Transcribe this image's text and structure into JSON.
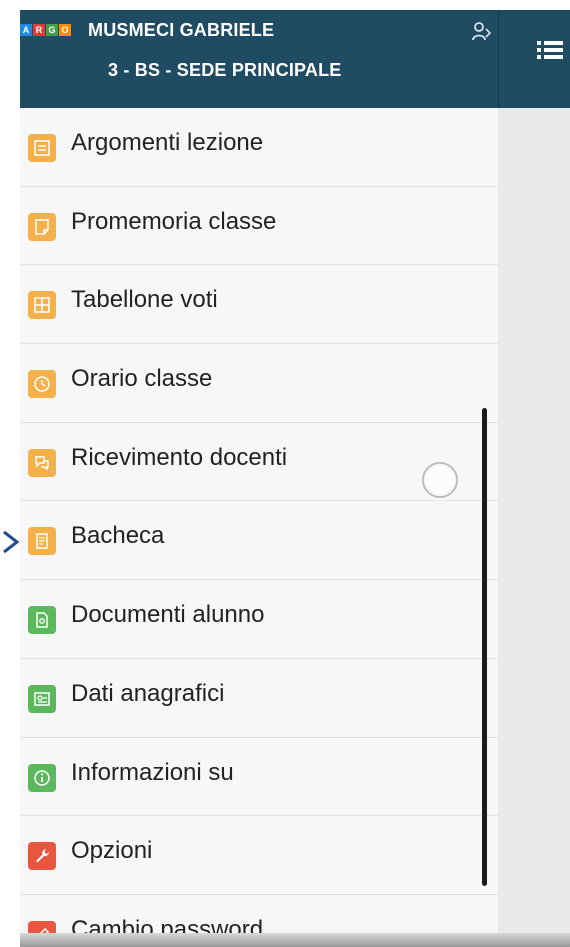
{
  "header": {
    "logo_text": "ARGO",
    "user_name": "MUSMECI GABRIELE",
    "user_class": "3 - BS - SEDE PRINCIPALE",
    "switch_user_icon": "user-switch-icon",
    "menu_icon": "hamburger-list-icon"
  },
  "colors": {
    "header_bg": "#1f4b63",
    "orange_icon": "#f4b04a",
    "green_icon": "#5cb85c",
    "red_icon": "#e8563f",
    "logo_a": "#1e88e5",
    "logo_r": "#e53935",
    "logo_g": "#43a047",
    "logo_o": "#fb8c00"
  },
  "menu": {
    "items": [
      {
        "label": "Argomenti lezione",
        "icon": "lesson-topics-icon",
        "color": "#f4b04a"
      },
      {
        "label": "Promemoria classe",
        "icon": "class-reminder-icon",
        "color": "#f4b04a"
      },
      {
        "label": "Tabellone voti",
        "icon": "grades-board-icon",
        "color": "#f4b04a"
      },
      {
        "label": "Orario classe",
        "icon": "class-timetable-icon",
        "color": "#f4b04a"
      },
      {
        "label": "Ricevimento docenti",
        "icon": "teacher-meeting-icon",
        "color": "#f4b04a"
      },
      {
        "label": "Bacheca",
        "icon": "noticeboard-icon",
        "color": "#f4b04a"
      },
      {
        "label": "Documenti alunno",
        "icon": "student-documents-icon",
        "color": "#5cb85c"
      },
      {
        "label": "Dati anagrafici",
        "icon": "personal-data-icon",
        "color": "#5cb85c"
      },
      {
        "label": "Informazioni su",
        "icon": "info-icon",
        "color": "#5cb85c"
      },
      {
        "label": "Opzioni",
        "icon": "wrench-icon",
        "color": "#e8563f"
      },
      {
        "label": "Cambio password",
        "icon": "pencil-icon",
        "color": "#e8563f"
      }
    ]
  }
}
